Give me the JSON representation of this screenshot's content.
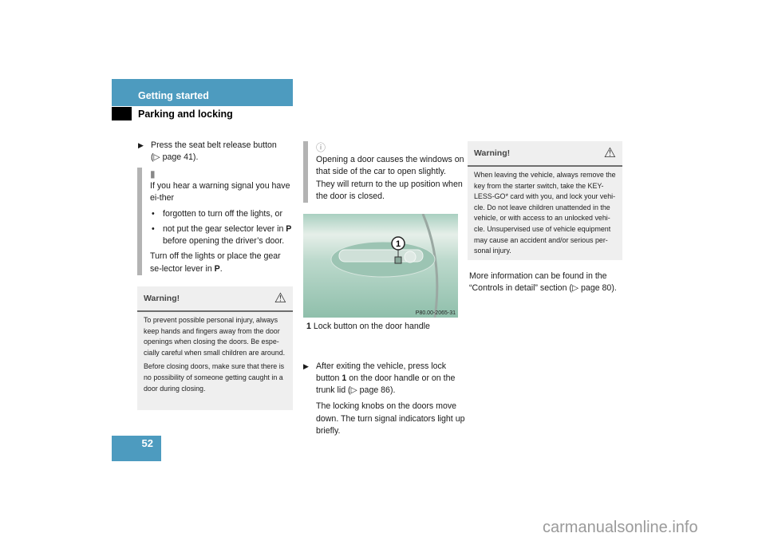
{
  "header": {
    "section": "Getting started",
    "subsection": "Parking and locking"
  },
  "page_number": "52",
  "col1": {
    "step1": {
      "text": "Press the seat belt release button",
      "ref": "(▷ page 41)."
    },
    "note": {
      "icon": "!",
      "intro": "If you hear a warning signal you have ei-ther",
      "bullets": [
        "forgotten to turn off the lights, or",
        "not put the gear selector lever in ",
        "before opening the driver’s door."
      ],
      "bullet_bold": "P",
      "outro": "Turn off the lights or place the gear se-lector lever in ",
      "outro_bold": "P",
      "outro_end": "."
    },
    "warning": {
      "title": "Warning!",
      "p1": "To prevent possible personal injury, always keep hands and fingers away from the door openings when closing the doors. Be espe-cially careful when small children are around.",
      "p2": "Before closing doors, make sure that there is no possibility of someone getting caught in a door during closing."
    }
  },
  "col2": {
    "note": {
      "icon": "i",
      "text": "Opening a door causes the windows on that side of the car to open slightly. They will return to the up position when the door is closed."
    },
    "image": {
      "callout": "1",
      "code": "P80.00-2065-31"
    },
    "caption": {
      "num": "1",
      "text": "Lock button on the door handle"
    },
    "step": {
      "a": "After exiting the vehicle, press lock button ",
      "num": "1",
      "b": " on the door handle or on the trunk lid (▷ page 86)."
    },
    "para": "The locking knobs on the doors move down. The turn signal indicators light up briefly."
  },
  "col3": {
    "warning": {
      "title": "Warning!",
      "text": "When leaving the vehicle, always remove the key from the starter switch, take the KEY-LESS-GO* card with you, and lock your vehi-cle. Do not leave children unattended in the vehicle, or with access to an unlocked vehi-cle. Unsupervised use of vehicle equipment may cause an accident and/or serious per-sonal injury."
    },
    "more_info": "More information can be found in the “Controls in detail” section (▷ page 80)."
  },
  "watermark": "carmanualsonline.info"
}
